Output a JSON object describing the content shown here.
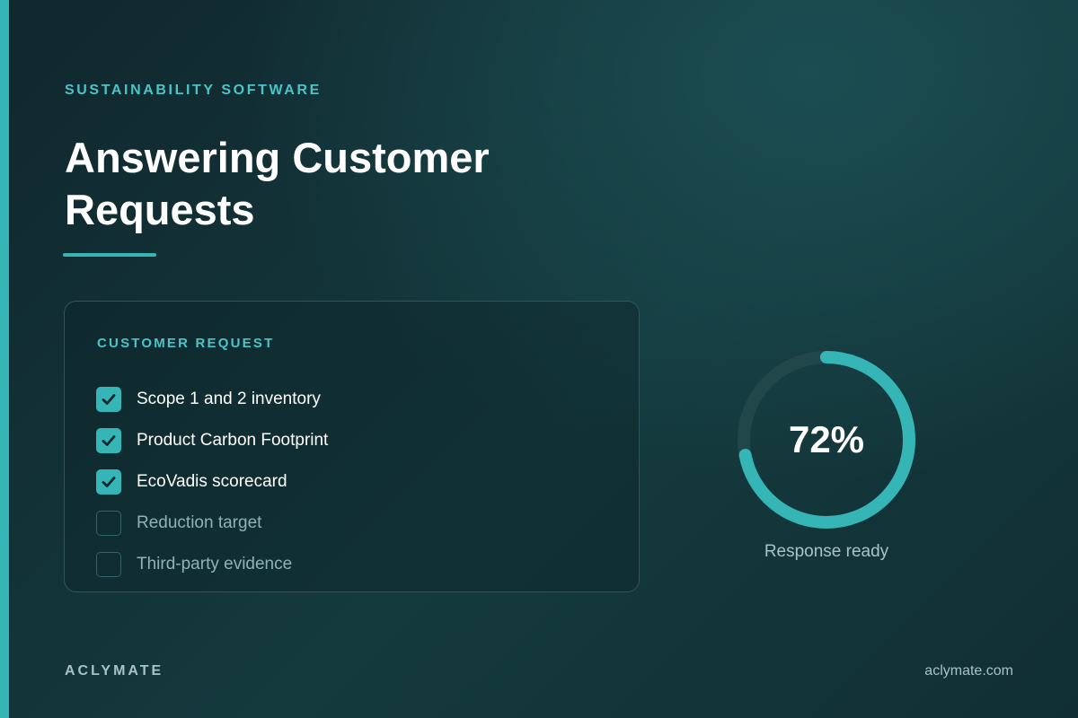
{
  "eyebrow": "SUSTAINABILITY SOFTWARE",
  "headline": "Answering Customer Requests",
  "card": {
    "heading": "CUSTOMER REQUEST",
    "items": [
      {
        "label": "Scope 1 and 2 inventory",
        "checked": true
      },
      {
        "label": "Product Carbon Footprint",
        "checked": true
      },
      {
        "label": "EcoVadis scorecard",
        "checked": true
      },
      {
        "label": "Reduction target",
        "checked": false
      },
      {
        "label": "Third-party evidence",
        "checked": false
      }
    ]
  },
  "progress": {
    "value": 72,
    "display": "72%",
    "caption": "Response ready"
  },
  "footer": {
    "brand": "ACLYMATE",
    "site": "aclymate.com"
  },
  "colors": {
    "accent": "#35b5b5",
    "background": "#143a3e",
    "track": "#21474b"
  },
  "icons": {
    "checked": "checkmark-icon",
    "unchecked": "empty-checkbox-icon"
  }
}
